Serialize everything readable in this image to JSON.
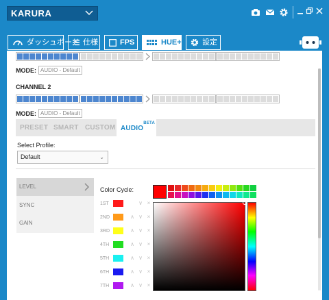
{
  "header": {
    "device_name": "KARURA"
  },
  "tabs": [
    {
      "label": "ダッシュボード",
      "icon": "gauge-icon"
    },
    {
      "label": "仕様",
      "icon": "list-icon"
    },
    {
      "label": "FPS",
      "icon": "square-icon"
    },
    {
      "label": "HUE+",
      "icon": "led-strip-icon",
      "active": true
    },
    {
      "label": "設定",
      "icon": "gear-icon"
    }
  ],
  "channels": {
    "channel1_mode_label": "MODE:",
    "channel1_mode_value": "AUDIO - Default",
    "channel2_title": "CHANNEL 2",
    "channel2_mode_label": "MODE:",
    "channel2_mode_value": "AUDIO - Default"
  },
  "subtabs": {
    "preset": "PRESET",
    "smart": "SMART",
    "custom": "CUSTOM",
    "audio": "AUDIO",
    "beta": "BETA"
  },
  "profile": {
    "label": "Select Profile:",
    "value": "Default"
  },
  "settings_menu": [
    "LEVEL",
    "SYNC",
    "GAIN"
  ],
  "color_cycle": {
    "label": "Color Cycle:",
    "rows": [
      {
        "name": "1ST",
        "color": "#ff1a1a"
      },
      {
        "name": "2ND",
        "color": "#ff9a1a"
      },
      {
        "name": "3RD",
        "color": "#ffff1a"
      },
      {
        "name": "4TH",
        "color": "#22dd22"
      },
      {
        "name": "5TH",
        "color": "#1af0f0"
      },
      {
        "name": "6TH",
        "color": "#1a1af0"
      },
      {
        "name": "7TH",
        "color": "#b01af0"
      }
    ]
  },
  "picker": {
    "selected_color": "#ff0000",
    "palette": [
      "#e01010",
      "#e62828",
      "#ee4a1a",
      "#f06a10",
      "#f28a10",
      "#f5aa10",
      "#f8cc10",
      "#f2ee10",
      "#c8ee10",
      "#90e810",
      "#55e010",
      "#28d820",
      "#10d040",
      "#e81050",
      "#e01090",
      "#c810c0",
      "#9010e0",
      "#5818e8",
      "#2030f0",
      "#1060f0",
      "#1090f0",
      "#10b8f0",
      "#10d8e8",
      "#10e8c0",
      "#10e890",
      "#10e060"
    ]
  }
}
